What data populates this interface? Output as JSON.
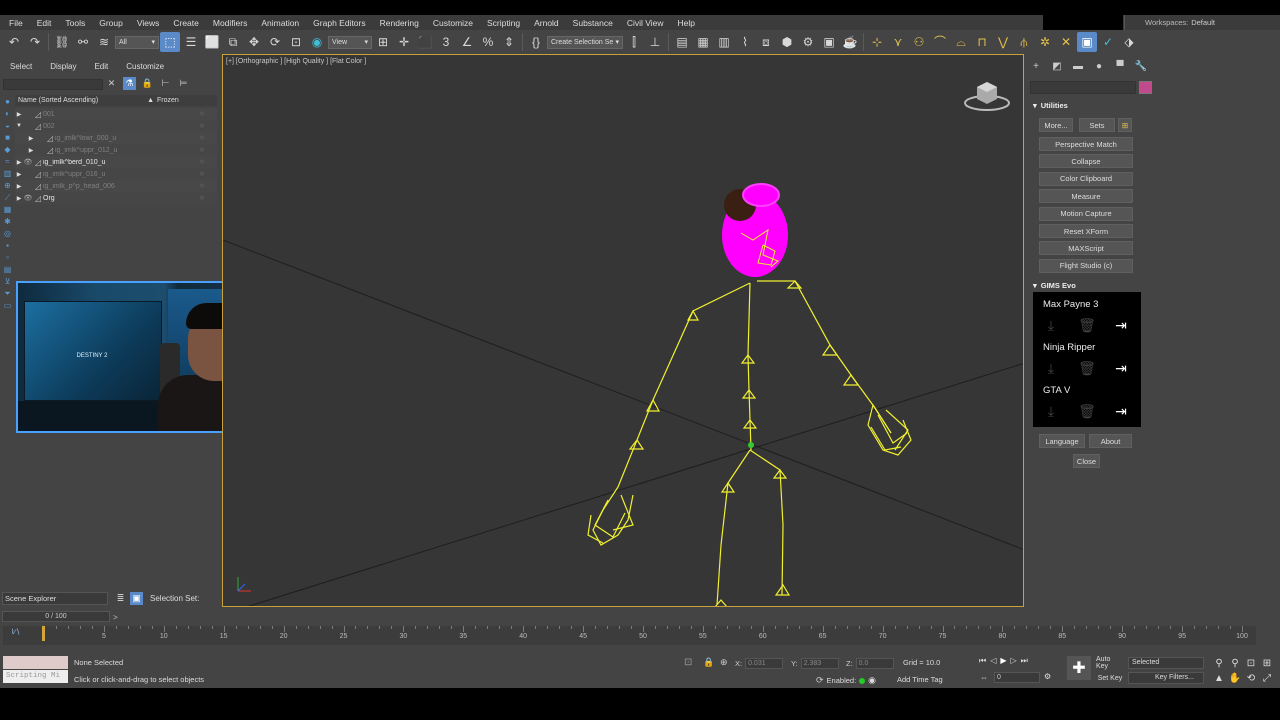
{
  "menubar": {
    "items": [
      "File",
      "Edit",
      "Tools",
      "Group",
      "Views",
      "Create",
      "Modifiers",
      "Animation",
      "Graph Editors",
      "Rendering",
      "Customize",
      "Scripting",
      "Arnold",
      "Substance",
      "Civil View",
      "Help"
    ],
    "workspace_label": "Workspaces:",
    "workspace_value": "Default"
  },
  "toolbar": {
    "selection_filter": "All",
    "ref_coord": "View",
    "named_selection": "Create Selection Se"
  },
  "scene_explorer": {
    "menu": [
      "Select",
      "Display",
      "Edit",
      "Customize"
    ],
    "header_name": "Name (Sorted Ascending)",
    "header_frozen": "Frozen",
    "rows": [
      {
        "name": "001",
        "style": "dim",
        "indent": 0,
        "expanded": false,
        "eye": false
      },
      {
        "name": "002",
        "style": "dim",
        "indent": 0,
        "expanded": true,
        "eye": false
      },
      {
        "name": "ig_imlk^lowr_000_u",
        "style": "dim",
        "indent": 1,
        "expanded": false,
        "eye": false
      },
      {
        "name": "ig_imlk^uppr_012_u",
        "style": "dim",
        "indent": 1,
        "expanded": false,
        "eye": false
      },
      {
        "name": "ig_imlk^berd_010_u",
        "style": "bright",
        "indent": 0,
        "expanded": false,
        "eye": true
      },
      {
        "name": "ig_imlk^uppr_016_u",
        "style": "dim",
        "indent": 0,
        "expanded": false,
        "eye": false
      },
      {
        "name": "ig_imlk_p^p_head_006",
        "style": "dim",
        "indent": 0,
        "expanded": false,
        "eye": false
      },
      {
        "name": "Org",
        "style": "bright",
        "indent": 0,
        "expanded": false,
        "eye": true
      }
    ],
    "bottom_tab": "Scene Explorer",
    "selection_set_label": "Selection Set:"
  },
  "webcam": {
    "screen_logo": "DESTINY 2"
  },
  "viewport": {
    "label": "[+] [Orthographic ] [High Quality ] [Flat Color ]",
    "colors": {
      "skeleton": "#f0f030",
      "head": "#ff00ff",
      "grid_lines": "#1e1e1e"
    }
  },
  "utilities": {
    "title": "Utilities",
    "more_button": "More...",
    "sets_button": "Sets",
    "buttons": [
      "Perspective Match",
      "Collapse",
      "Color Clipboard",
      "Measure",
      "Motion Capture",
      "Reset XForm",
      "MAXScript",
      "Flight Studio (c)"
    ]
  },
  "gims": {
    "title": "GIMS Evo",
    "games": [
      "Max Payne 3",
      "Ninja Ripper",
      "GTA V"
    ],
    "language_button": "Language",
    "about_button": "About",
    "close_button": "Close"
  },
  "timeline": {
    "slider_text": "0 / 100",
    "ticks": [
      0,
      5,
      10,
      15,
      20,
      25,
      30,
      35,
      40,
      45,
      50,
      55,
      60,
      65,
      70,
      75,
      80,
      85,
      90,
      95,
      100
    ],
    "labels": [
      "5",
      "10",
      "15",
      "20",
      "25",
      "30",
      "35",
      "40",
      "45",
      "50",
      "55",
      "60",
      "65",
      "70",
      "75",
      "80",
      "85",
      "90",
      "95",
      "100"
    ],
    "current_frame": 0
  },
  "status": {
    "maxscript_text": "Scripting Mi",
    "selection_status": "None Selected",
    "prompt": "Click or click-and-drag to select objects",
    "x_label": "X:",
    "x_value": "0.031",
    "y_label": "Y:",
    "y_value": "2.383",
    "z_label": "Z:",
    "z_value": "0.0",
    "grid": "Grid = 10.0",
    "enabled": "Enabled:",
    "add_time_tag": "Add Time Tag",
    "frame_value": "0",
    "auto_key": "Auto Key",
    "set_key": "Set Key",
    "key_filter_select": "Selected",
    "key_filters": "Key Filters..."
  }
}
